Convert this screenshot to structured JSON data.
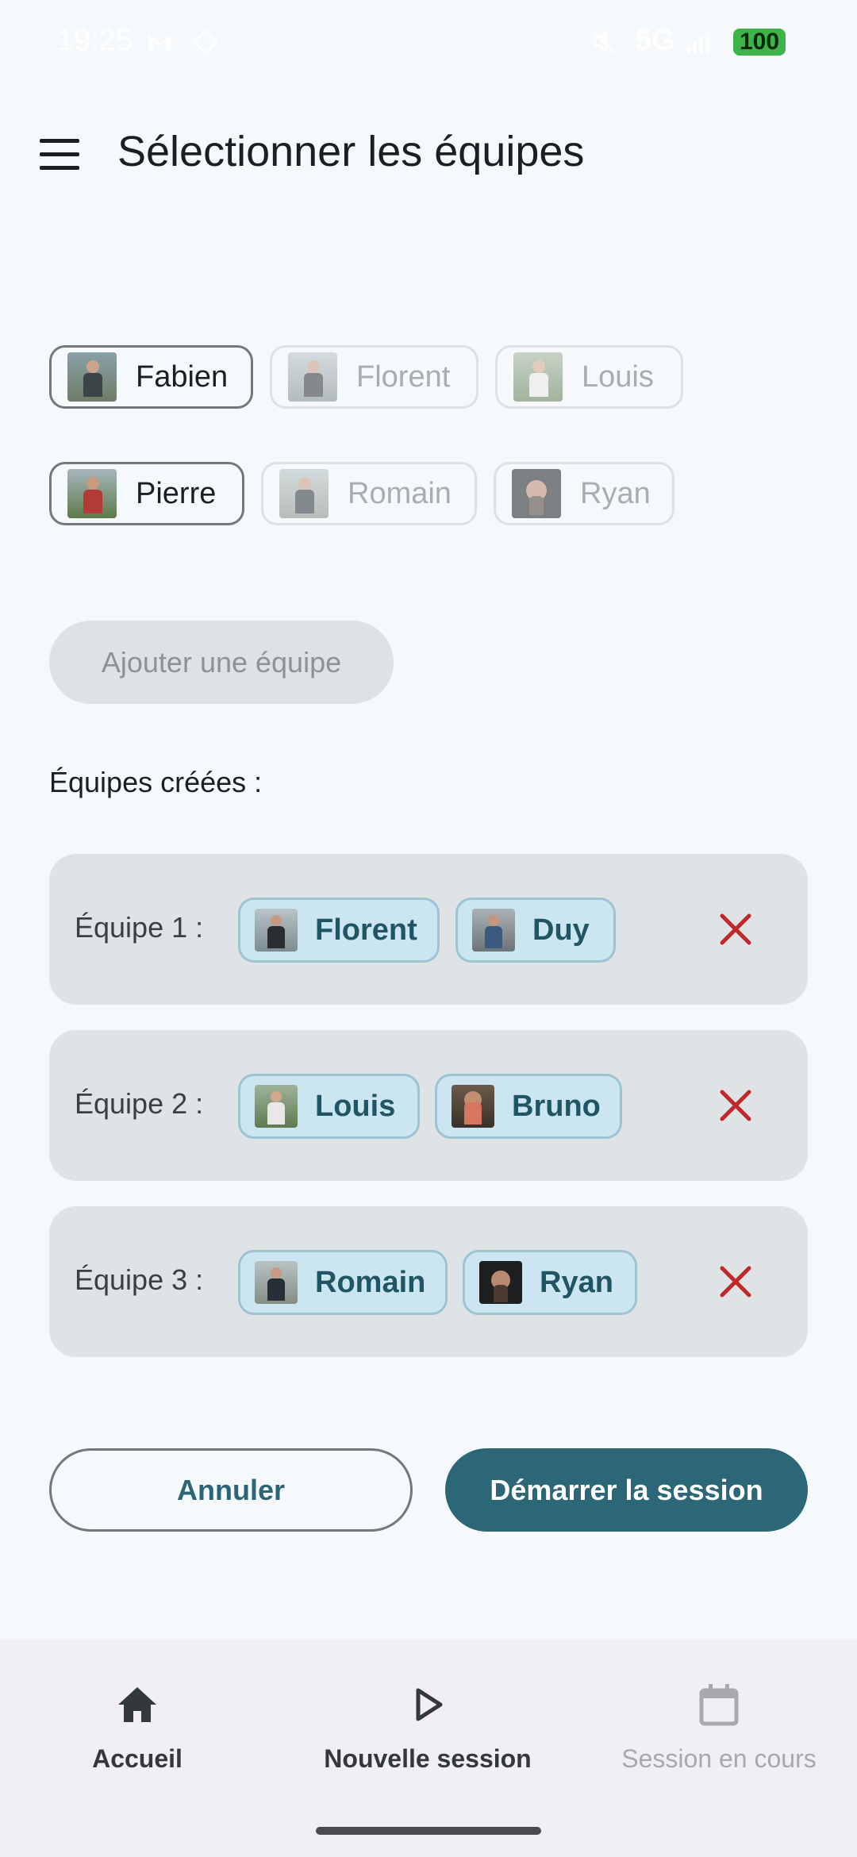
{
  "status_bar": {
    "time": "19:25",
    "network": "5G",
    "battery": "100"
  },
  "header": {
    "title": "Sélectionner les équipes"
  },
  "players": [
    {
      "name": "Fabien",
      "state": "selected"
    },
    {
      "name": "Florent",
      "state": "disabled"
    },
    {
      "name": "Louis",
      "state": "disabled"
    },
    {
      "name": "Pierre",
      "state": "selected"
    },
    {
      "name": "Romain",
      "state": "disabled"
    },
    {
      "name": "Ryan",
      "state": "disabled"
    }
  ],
  "add_team_label": "Ajouter une équipe",
  "teams_heading": "Équipes créées :",
  "teams": [
    {
      "label": "Équipe 1 :",
      "members": [
        "Florent",
        "Duy"
      ]
    },
    {
      "label": "Équipe 2 :",
      "members": [
        "Louis",
        "Bruno"
      ]
    },
    {
      "label": "Équipe 3 :",
      "members": [
        "Romain",
        "Ryan"
      ]
    }
  ],
  "actions": {
    "cancel": "Annuler",
    "start": "Démarrer la session"
  },
  "bottom_nav": [
    {
      "label": "Accueil",
      "icon": "home-icon",
      "state": "normal"
    },
    {
      "label": "Nouvelle session",
      "icon": "play-icon",
      "state": "active"
    },
    {
      "label": "Session en cours",
      "icon": "calendar-icon",
      "state": "disabled"
    }
  ],
  "colors": {
    "primary": "#2b6777",
    "chip_bg": "#cbe6f0",
    "remove": "#c0282a",
    "background": "#f6f9fb"
  }
}
